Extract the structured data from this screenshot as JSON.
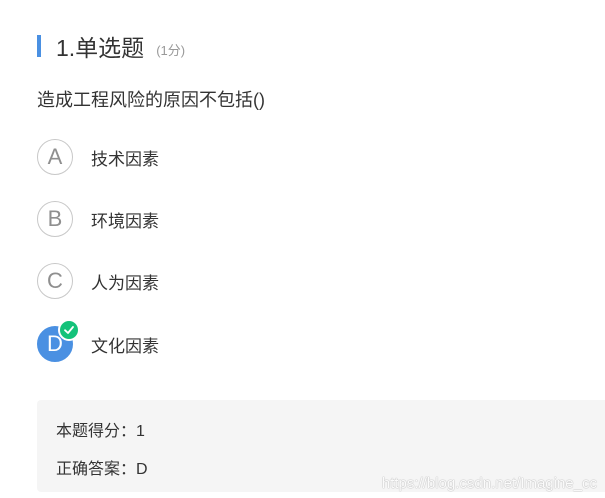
{
  "question": {
    "number_type": "1.单选题",
    "score": "(1分)",
    "text": "造成工程风险的原因不包括()"
  },
  "options": [
    {
      "letter": "A",
      "text": "技术因素",
      "selected": false
    },
    {
      "letter": "B",
      "text": "环境因素",
      "selected": false
    },
    {
      "letter": "C",
      "text": "人为因素",
      "selected": false
    },
    {
      "letter": "D",
      "text": "文化因素",
      "selected": true
    }
  ],
  "result": {
    "score_line": "本题得分：1",
    "answer_line": "正确答案：D"
  },
  "watermark": "https://blog.csdn.net/Imagine_cc",
  "colors": {
    "accent": "#4a90e2",
    "check": "#14c27a",
    "result_bg": "#f5f5f5"
  },
  "icons": {
    "check": "check-icon"
  }
}
